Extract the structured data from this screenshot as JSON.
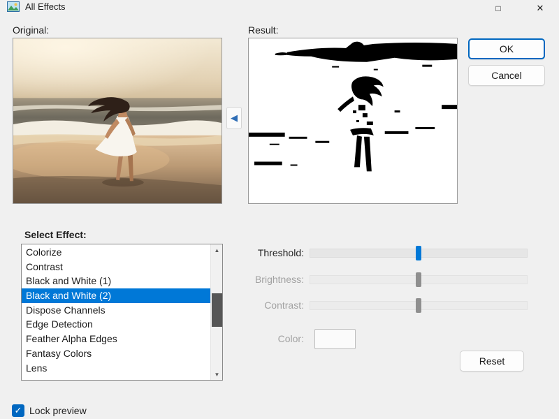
{
  "window": {
    "title": "All Effects"
  },
  "icons": {
    "maximize": "□",
    "close": "✕",
    "arrow_left": "◀",
    "scroll_up": "▲",
    "scroll_down": "▼",
    "check": "✓"
  },
  "panels": {
    "original_label": "Original:",
    "result_label": "Result:"
  },
  "buttons": {
    "ok": "OK",
    "cancel": "Cancel",
    "reset": "Reset"
  },
  "effect_list": {
    "label": "Select Effect:",
    "items": [
      "Colorize",
      "Contrast",
      "Black and White (1)",
      "Black and White (2)",
      "Dispose Channels",
      "Edge Detection",
      "Feather Alpha Edges",
      "Fantasy Colors",
      "Lens"
    ],
    "selected": "Black and White (2)",
    "selected_index": 3
  },
  "controls": {
    "sliders": [
      {
        "label": "Threshold:",
        "enabled": true,
        "value_pct": 50
      },
      {
        "label": "Brightness:",
        "enabled": false,
        "value_pct": 50
      },
      {
        "label": "Contrast:",
        "enabled": false,
        "value_pct": 50
      }
    ],
    "color_label": "Color:"
  },
  "footer": {
    "lock_preview_label": "Lock preview",
    "lock_preview_checked": true
  },
  "colors": {
    "selection": "#0078d7",
    "accent": "#0067c0",
    "slider_thumb_enabled": "#0078d7",
    "slider_thumb_disabled": "#8f8f8f"
  }
}
